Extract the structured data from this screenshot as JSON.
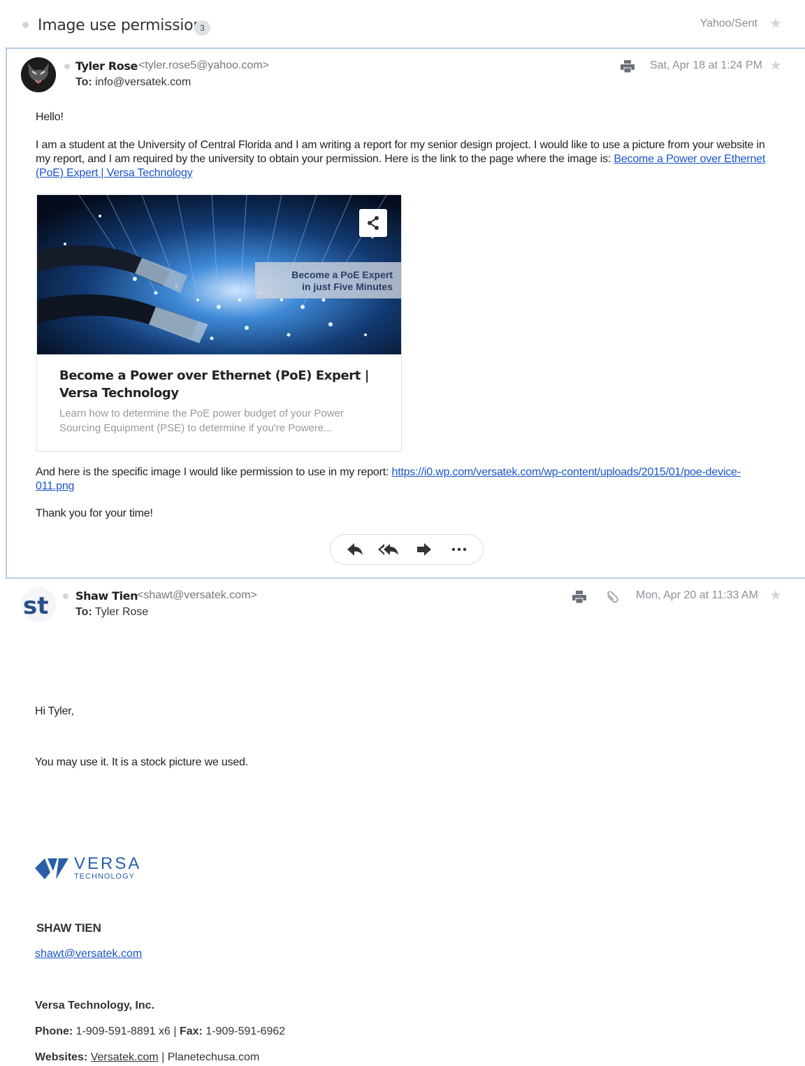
{
  "thread": {
    "title": "Image use permission",
    "count": "3",
    "folder": "Yahoo/Sent"
  },
  "message1": {
    "sender_name": "Tyler Rose",
    "sender_email": "<tyler.rose5@yahoo.com>",
    "to_label": "To:",
    "to_value": "info@versatek.com",
    "date": "Sat, Apr 18 at 1:24 PM",
    "greeting": "Hello!",
    "para1": "I am a student at the University of Central Florida and I am writing a report for my senior design project. I would like to use a picture from your website in my report, and I am required by the university to obtain your permission. Here is the link to the page where the image is:",
    "para1_link": "Become a Power over Ethernet (PoE) Expert | Versa Technology",
    "card": {
      "banner_line1": "Become a PoE Expert",
      "banner_line2": "in just Five Minutes",
      "title": "Become a Power over Ethernet (PoE) Expert | Versa Technology",
      "description": "Learn how to determine the PoE power budget of your Power Sourcing Equipment (PSE) to determine if you're Powere..."
    },
    "para2": "And here is the specific image I would like permission to use in my report:",
    "para2_link": "https://i0.wp.com/versatek.com/wp-content/uploads/2015/01/poe-device-011.png",
    "closing": "Thank you for your time!"
  },
  "message2": {
    "sender_name": "Shaw Tien",
    "sender_email": "<shawt@versatek.com>",
    "to_label": "To:",
    "to_value": "Tyler Rose",
    "date": "Mon, Apr 20 at 11:33 AM",
    "greeting": "Hi Tyler,",
    "body": "You may use it. It is a stock picture we used.",
    "logo": {
      "text": "VERSA",
      "subtext": "TECHNOLOGY"
    },
    "signature": {
      "name": "SHAW TIEN",
      "email": "shawt@versatek.com",
      "company": "Versa Technology, Inc.",
      "phone_label": "Phone:",
      "phone_value": "1-909-591-8891 x6",
      "fax_label": "Fax:",
      "fax_value": "1-909-591-6962",
      "websites_label": "Websites:",
      "website1": "Versatek.com",
      "website2": "Planetechusa.com"
    }
  },
  "avatar2_text": "st",
  "colors": {
    "link": "#1a55c8",
    "focus_border": "#b9cbe8",
    "muted": "#8b9199",
    "versa_blue": "#2a5fa8"
  }
}
